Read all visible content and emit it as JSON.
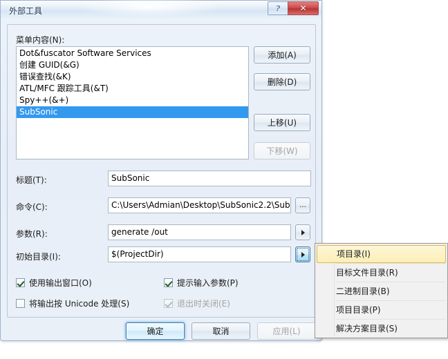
{
  "window": {
    "title": "外部工具",
    "help_button": "?",
    "close_button": "✕"
  },
  "menu_contents": {
    "label": "菜单内容(N):",
    "items": [
      {
        "label": "Dot&fuscator Software Services",
        "selected": false
      },
      {
        "label": "创建 GUID(&G)",
        "selected": false
      },
      {
        "label": "错误查找(&K)",
        "selected": false
      },
      {
        "label": "ATL/MFC 跟踪工具(&T)",
        "selected": false
      },
      {
        "label": "Spy++(&+)",
        "selected": false
      },
      {
        "label": "SubSonic",
        "selected": true
      }
    ]
  },
  "side_buttons": {
    "add": "添加(A)",
    "delete": "删除(D)",
    "move_up": "上移(U)",
    "move_down": "下移(W)"
  },
  "fields": {
    "title": {
      "label": "标题(T):",
      "value": "SubSonic"
    },
    "command": {
      "label": "命令(C):",
      "value": "C:\\Users\\Admian\\Desktop\\SubSonic2.2\\Sub",
      "browse_button": "..."
    },
    "arguments": {
      "label": "参数(R):",
      "value": "generate /out"
    },
    "initial_directory": {
      "label": "初始目录(I):",
      "value": "$(ProjectDir)"
    }
  },
  "checkboxes": {
    "use_output_window": {
      "label": "使用输出窗口(O)",
      "checked": true,
      "enabled": true
    },
    "prompt_for_arguments": {
      "label": "提示输入参数(P)",
      "checked": true,
      "enabled": true
    },
    "treat_output_as_unicode": {
      "label": "将输出按 Unicode 处理(S)",
      "checked": false,
      "enabled": true
    },
    "close_on_exit": {
      "label": "退出时关闭(E)",
      "checked": true,
      "enabled": false
    }
  },
  "dialog_buttons": {
    "ok": "确定",
    "cancel": "取消",
    "apply": "应用(L)"
  },
  "context_menu": {
    "items": [
      {
        "label": "项目录(I)",
        "highlighted": true
      },
      {
        "label": "目标文件目录(R)",
        "highlighted": false
      },
      {
        "label": "二进制目录(B)",
        "highlighted": false
      },
      {
        "label": "项目目录(P)",
        "highlighted": false
      },
      {
        "label": "解决方案目录(S)",
        "highlighted": false
      }
    ]
  },
  "colors": {
    "selection_blue": "#3399ef",
    "close_red": "#cd4a4a",
    "menu_highlight": "#fbefb8",
    "focus_blue": "#3c7fb1"
  }
}
